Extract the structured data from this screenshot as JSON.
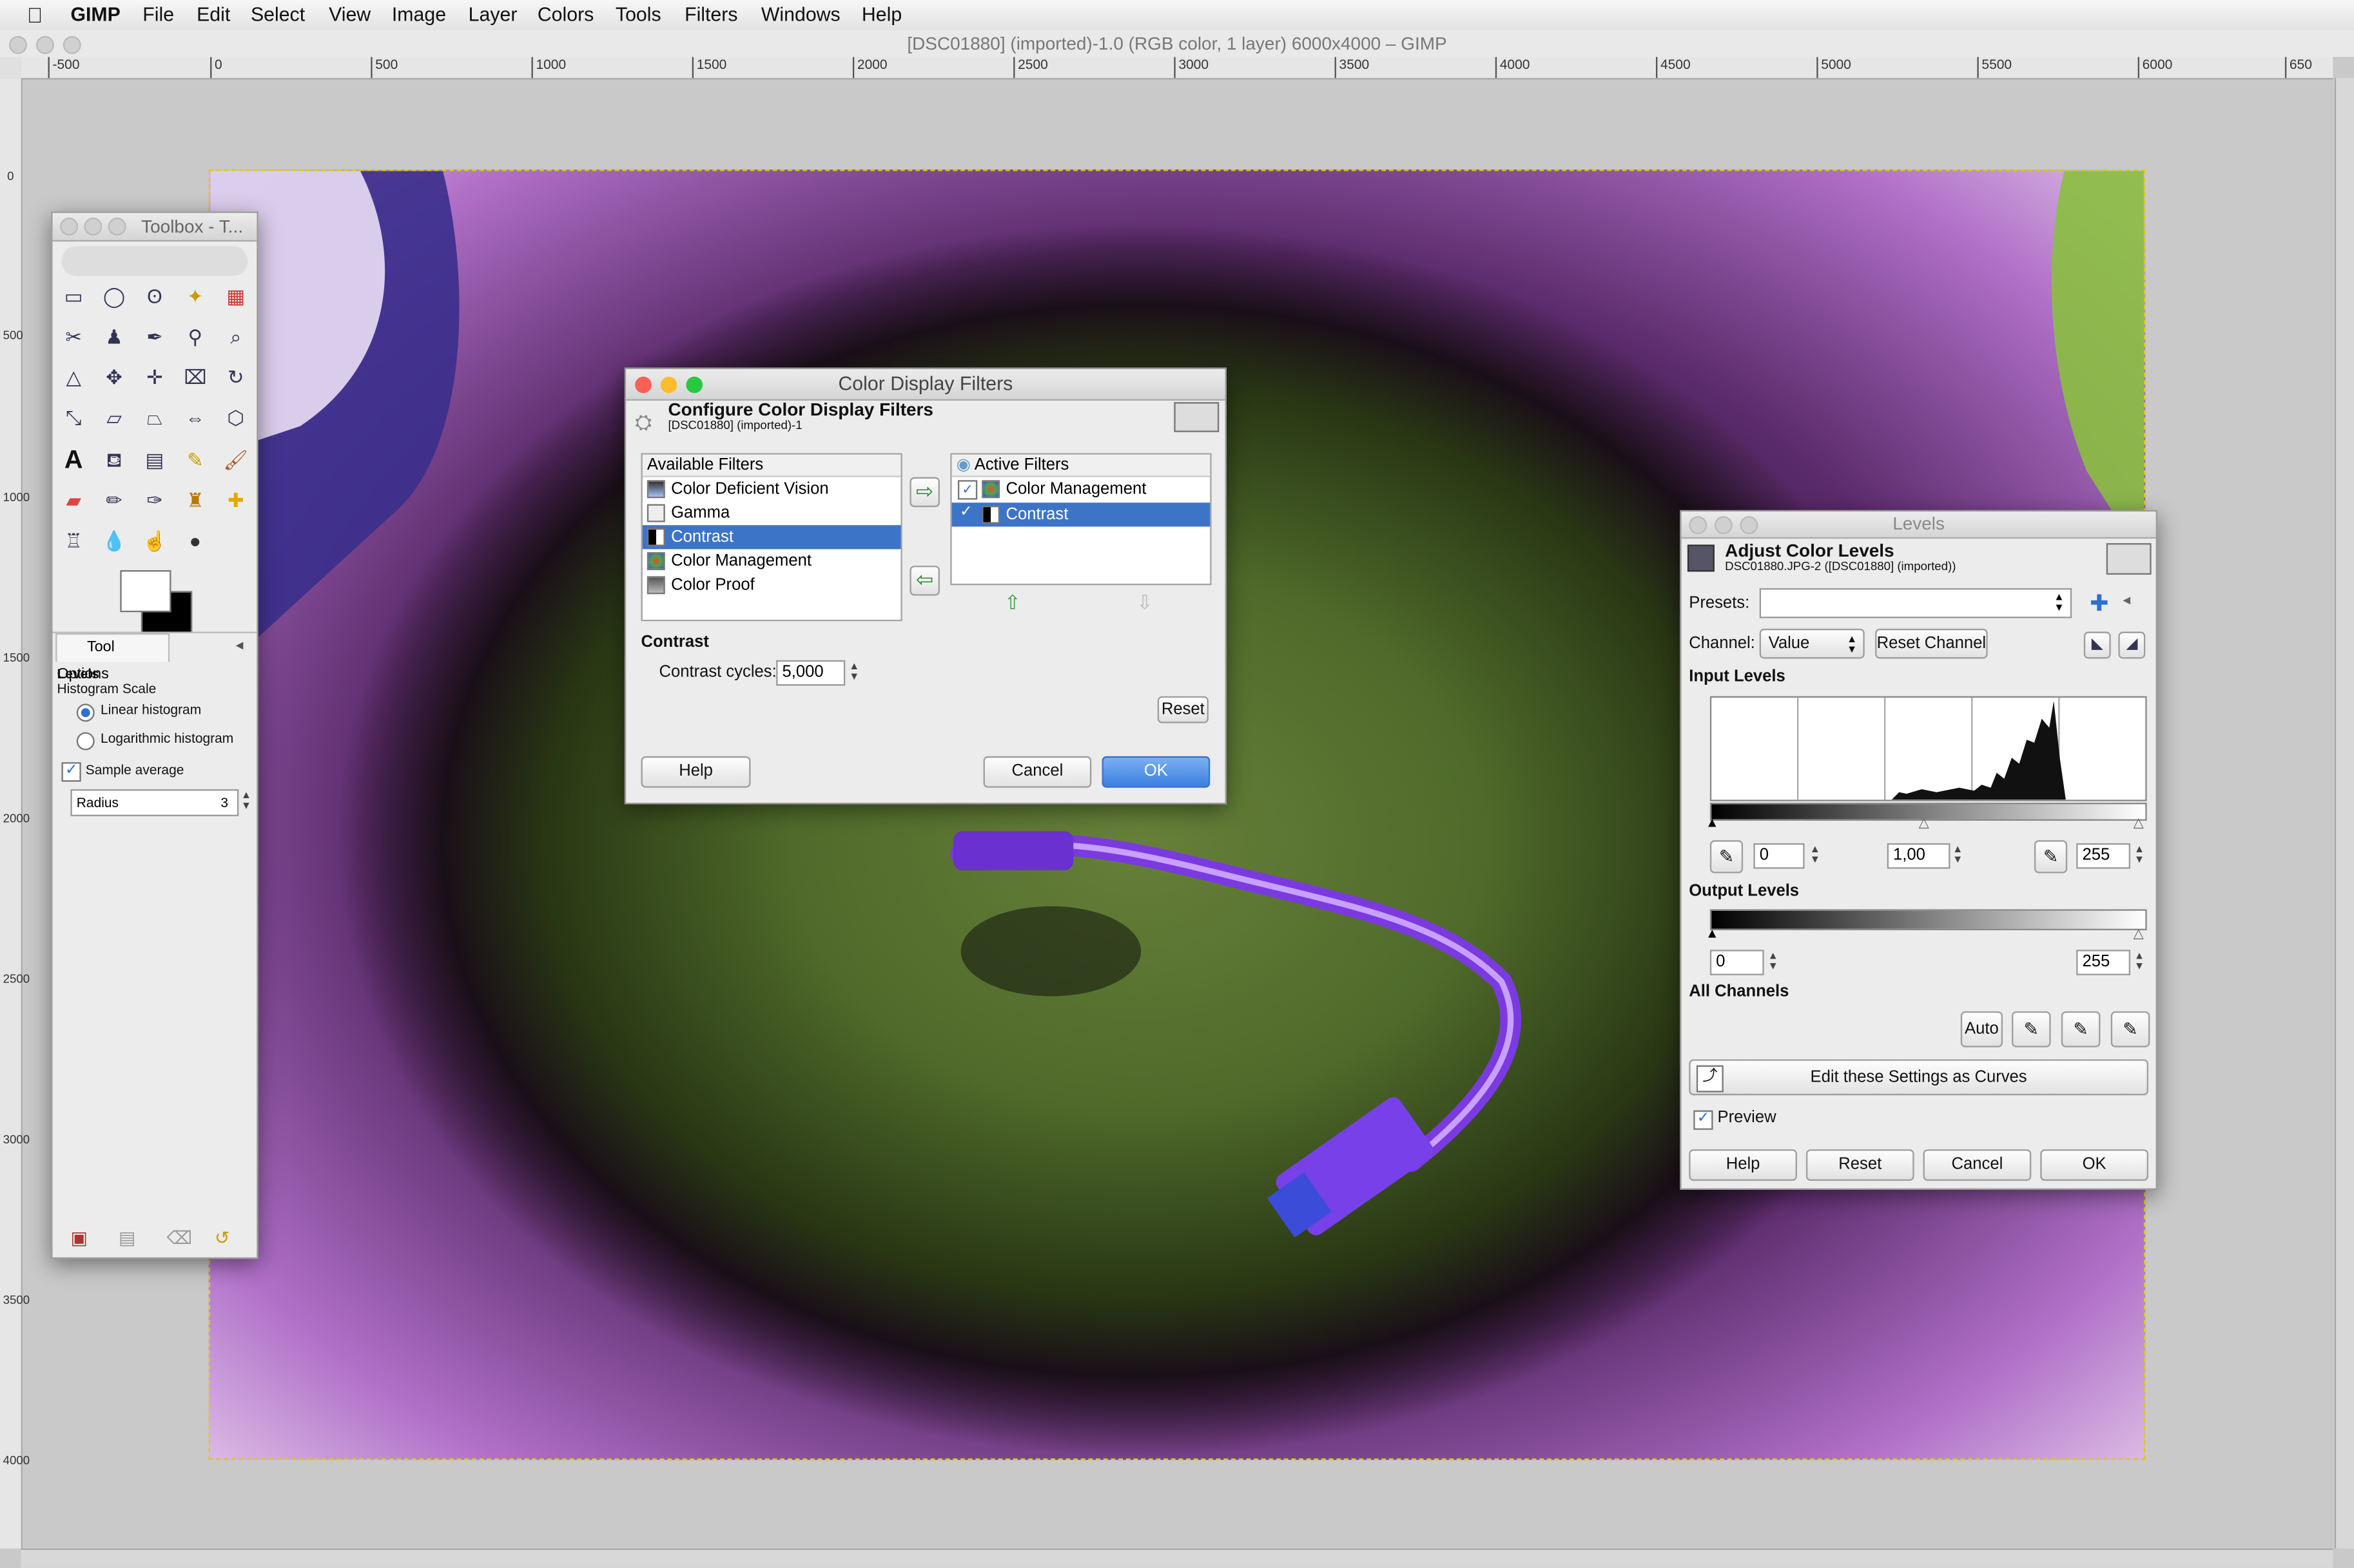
{
  "menubar": {
    "app": "GIMP",
    "items": [
      "File",
      "Edit",
      "Select",
      "View",
      "Image",
      "Layer",
      "Colors",
      "Tools",
      "Filters",
      "Windows",
      "Help"
    ]
  },
  "window": {
    "title": "[DSC01880] (imported)-1.0 (RGB color, 1 layer) 6000x4000 – GIMP"
  },
  "ruler": {
    "h_labels": [
      "-500",
      "0",
      "500",
      "1000",
      "1500",
      "2000",
      "2500",
      "3000",
      "3500",
      "4000",
      "4500",
      "5000",
      "5500",
      "6000",
      "650"
    ],
    "v_labels": [
      "0",
      "500",
      "1000",
      "1500",
      "2000",
      "2500",
      "3000",
      "3500",
      "4000"
    ]
  },
  "toolbox": {
    "title": "Toolbox - T...",
    "tool_icons": [
      "rect-select-icon",
      "ellipse-select-icon",
      "free-select-icon",
      "fuzzy-select-icon",
      "select-by-color-icon",
      "scissors-icon",
      "foreground-select-icon",
      "paths-icon",
      "color-picker-icon",
      "zoom-icon",
      "measure-icon",
      "move-icon",
      "align-icon",
      "crop-icon",
      "rotate-icon",
      "scale-icon",
      "shear-icon",
      "perspective-icon",
      "flip-icon",
      "cage-icon",
      "text-icon",
      "bucket-fill-icon",
      "blend-icon",
      "pencil-icon",
      "paintbrush-icon",
      "eraser-icon",
      "airbrush-icon",
      "ink-icon",
      "clone-icon",
      "heal-icon",
      "perspective-clone-icon",
      "blur-icon",
      "smudge-icon",
      "dodge-icon"
    ],
    "tool_options_tab": "Tool Options",
    "section": "Levels",
    "histogram_scale_label": "Histogram Scale",
    "linear": "Linear histogram",
    "logarithmic": "Logarithmic histogram",
    "sample_average": "Sample average",
    "radius_label": "Radius",
    "radius_value": "3"
  },
  "cdf": {
    "title": "Color Display Filters",
    "header": "Configure Color Display Filters",
    "subheader": "[DSC01880] (imported)-1",
    "available_header": "Available Filters",
    "available": [
      "Color Deficient Vision",
      "Gamma",
      "Contrast",
      "Color Management",
      "Color Proof"
    ],
    "active_header": "Active Filters",
    "active": [
      "Color Management",
      "Contrast"
    ],
    "section": "Contrast",
    "cycles_label": "Contrast cycles:",
    "cycles_value": "5,000",
    "reset": "Reset",
    "help": "Help",
    "cancel": "Cancel",
    "ok": "OK"
  },
  "levels": {
    "title": "Levels",
    "header": "Adjust Color Levels",
    "subheader": "DSC01880.JPG-2 ([DSC01880] (imported))",
    "presets_label": "Presets:",
    "channel_label": "Channel:",
    "channel_value": "Value",
    "reset_channel": "Reset Channel",
    "input_levels": "Input Levels",
    "in_low": "0",
    "in_gamma": "1,00",
    "in_high": "255",
    "output_levels": "Output Levels",
    "out_low": "0",
    "out_high": "255",
    "all_channels": "All Channels",
    "auto": "Auto",
    "edit_curves": "Edit these Settings as Curves",
    "preview": "Preview",
    "help": "Help",
    "reset": "Reset",
    "cancel": "Cancel",
    "ok": "OK"
  }
}
